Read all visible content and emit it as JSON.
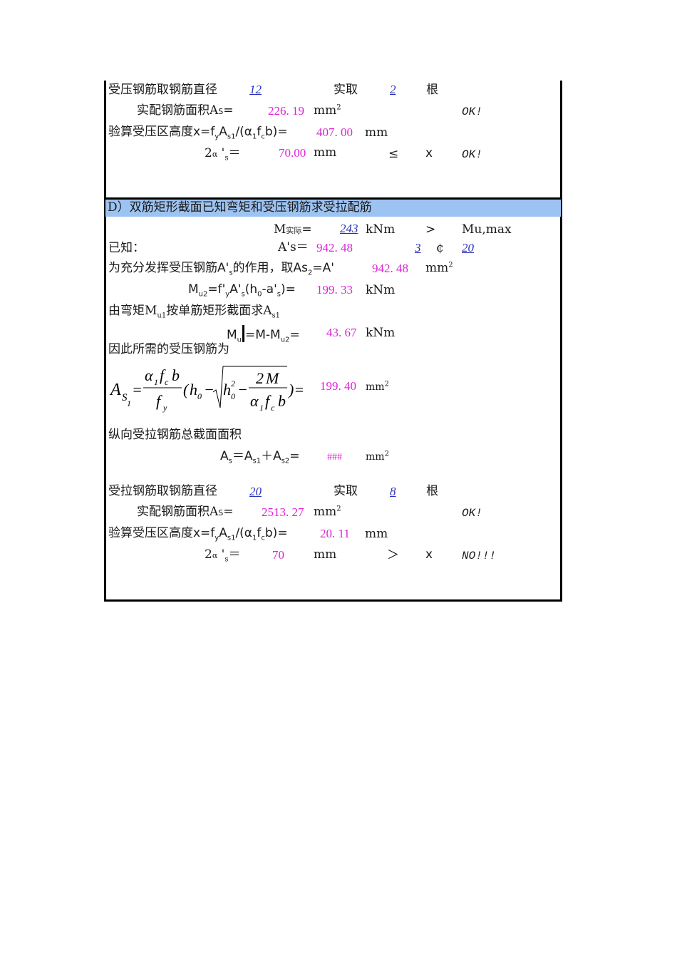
{
  "section_c_tail": {
    "compress_dia_label": "受压钢筋取钢筋直径",
    "compress_dia": "12",
    "take_label": "实取",
    "compress_count": "2",
    "count_unit": "根",
    "area_label": "实配钢筋面积A",
    "area_sub": "S",
    "area_eq": "=",
    "area_value": "226. 19",
    "area_unit": "mm",
    "area_status": "OK!",
    "x_label": "验算受压区高度",
    "x_formula": "x=fyAs1/(α1fcb)=",
    "x_value": "407. 00",
    "x_unit": "mm",
    "two_as_label": "2αˈs=",
    "two_as_value": "70.00",
    "two_as_unit": "mm",
    "compare": "≤",
    "x_symbol": "x",
    "check_status": "OK!"
  },
  "section_d": {
    "header": "D）双筋矩形截面已知弯矩和受压钢筋求受拉配筋",
    "m_actual_label": "M",
    "m_actual_sub": "实际",
    "m_actual_eq": "=",
    "m_actual_value": "243",
    "m_actual_unit": "kNm",
    "m_compare": ">",
    "m_compare_target": "Mu,max",
    "known_label": "已知：",
    "as_prime_label": "A's＝",
    "as_prime_value": "942. 48",
    "as_prime_count": "3",
    "as_prime_symbol": "¢",
    "as_prime_dia": "20",
    "as2_text": "为充分发挥受压钢筋A's的作用，取As₂=A'",
    "as2_value": "942. 48",
    "as2_unit": "mm",
    "mu2_formula": "Mu2=f'yA's(h0-a's)=",
    "mu2_value": "199. 33",
    "mu2_unit": "kNm",
    "mu1_desc": "由弯矩Mu1按单筋矩形截面求As1",
    "mu1_formula_a": "Mu",
    "mu1_formula_b": "=M-Mu2=",
    "mu1_value": "43. 67",
    "mu1_unit": "kNm",
    "required_label": "因此所需的受压钢筋为",
    "as1_value": "199. 40",
    "as1_unit": "mm",
    "total_label": "纵向受拉钢筋总截面面积",
    "total_formula": "As＝As1＋As2=",
    "total_value": "###",
    "total_unit": "mm",
    "tension_dia_label": "受拉钢筋取钢筋直径",
    "tension_dia": "20",
    "take_label": "实取",
    "tension_count": "8",
    "count_unit": "根",
    "area_label": "实配钢筋面积A",
    "area_value": "2513. 27",
    "area_unit": "mm",
    "area_status": "OK!",
    "x_label": "验算受压区高度",
    "x_value": "20. 11",
    "x_unit": "mm",
    "two_as_value": "70",
    "two_as_unit": "mm",
    "compare": "＞",
    "x_symbol": "x",
    "check_status": "NO!!!"
  },
  "colors": {
    "computed_value": "#e020d8",
    "input_value": "#2830b8",
    "header_bg": "#9dc3f2",
    "border": "#000000"
  }
}
